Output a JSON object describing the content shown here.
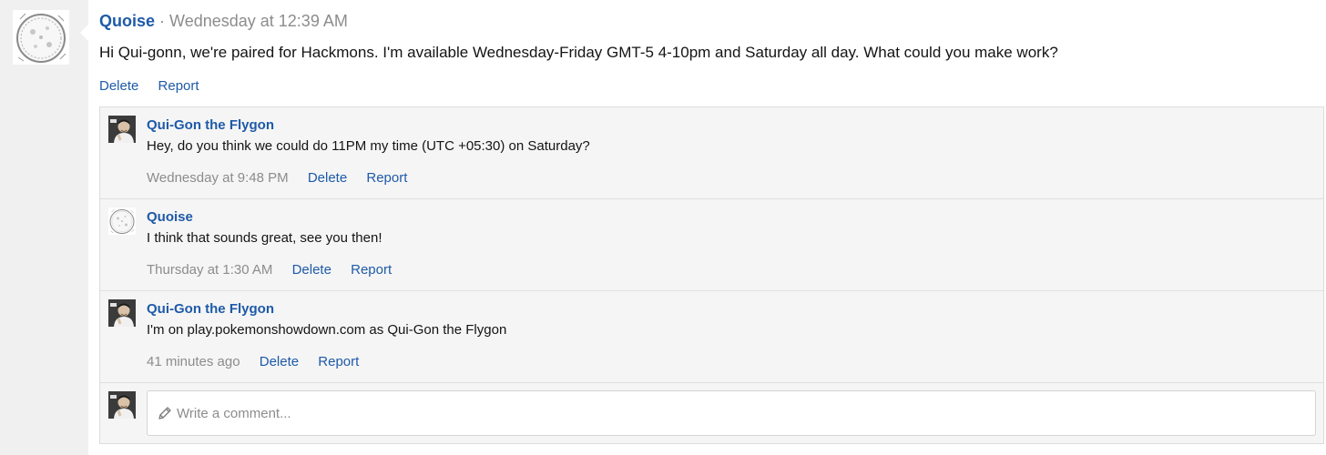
{
  "post": {
    "author": "Quoise",
    "separator": "·",
    "time": "Wednesday at 12:39 AM",
    "body": "Hi Qui-gonn, we're paired for Hackmons. I'm available Wednesday-Friday GMT-5 4-10pm and Saturday all day. What could you make work?",
    "actions": {
      "delete": "Delete",
      "report": "Report"
    }
  },
  "comments": [
    {
      "author": "Qui-Gon the Flygon",
      "text": "Hey, do you think we could do 11PM my time (UTC +05:30) on Saturday?",
      "time": "Wednesday at 9:48 PM",
      "delete": "Delete",
      "report": "Report",
      "avatar_icon": "man-photo-avatar"
    },
    {
      "author": "Quoise",
      "text": "I think that sounds great, see you then!",
      "time": "Thursday at 1:30 AM",
      "delete": "Delete",
      "report": "Report",
      "avatar_icon": "sketch-circle-avatar"
    },
    {
      "author": "Qui-Gon the Flygon",
      "text": "I'm on play.pokemonshowdown.com as Qui-Gon the Flygon",
      "time": "41 minutes ago",
      "delete": "Delete",
      "report": "Report",
      "avatar_icon": "man-photo-avatar"
    }
  ],
  "reply": {
    "placeholder": "Write a comment...",
    "icon": "pencil-icon"
  },
  "colors": {
    "link": "#1e5aa8",
    "muted": "#8c8c8c",
    "panel": "#f5f5f5",
    "gutter": "#f0f0f0"
  }
}
